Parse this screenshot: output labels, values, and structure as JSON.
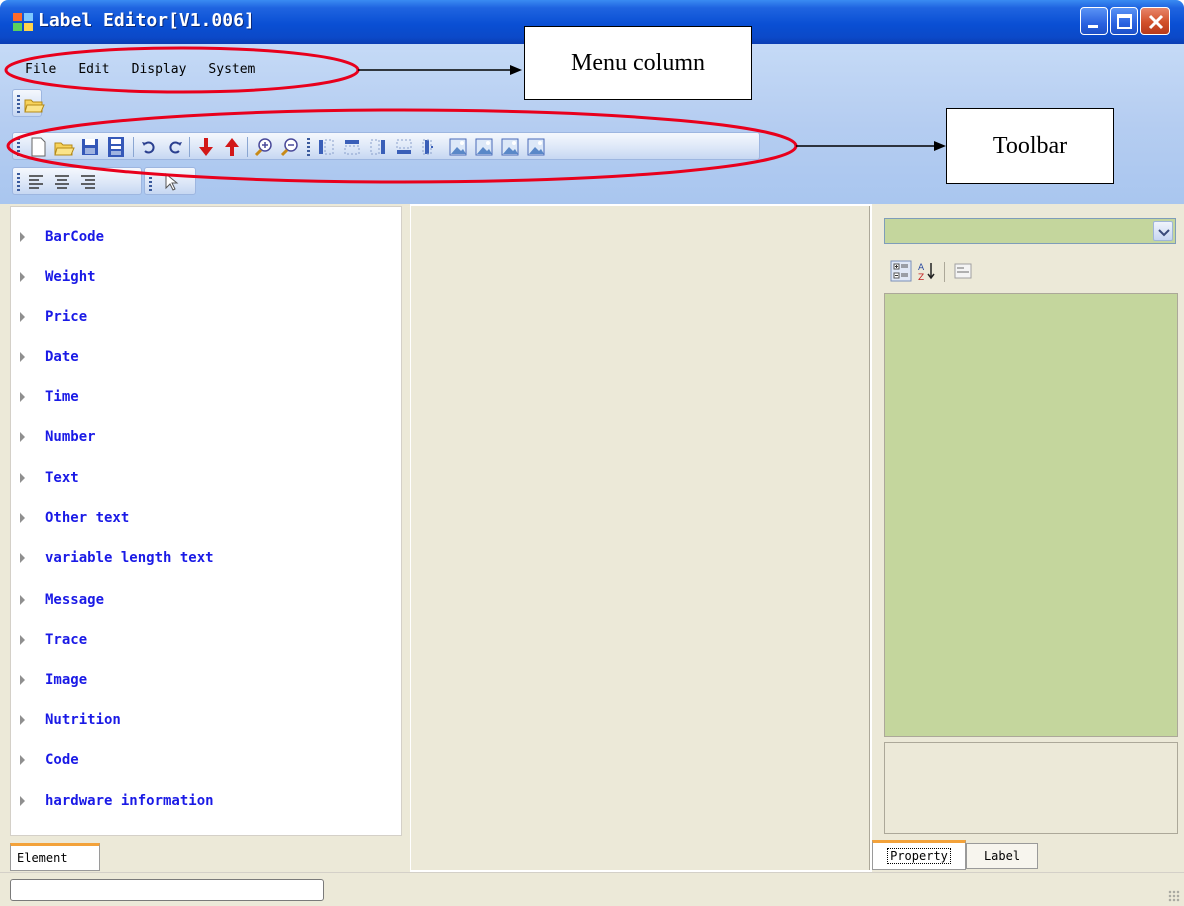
{
  "window": {
    "title": "Label Editor[V1.006]"
  },
  "menu": {
    "items": [
      "File",
      "Edit",
      "Display",
      "System"
    ]
  },
  "annotations": {
    "menu_callout": "Menu column",
    "toolbar_callout": "Toolbar",
    "highlight_color": "#e8001c"
  },
  "toolbar": {
    "row1": [
      "open-icon"
    ],
    "row2": [
      "new-icon",
      "open-folder-icon",
      "save-icon",
      "save-as-icon",
      "undo-icon",
      "redo-icon",
      "move-down-icon",
      "move-up-icon",
      "zoom-in-icon",
      "zoom-out-icon",
      "align-left-icon",
      "align-top-icon",
      "align-right-icon",
      "align-bottom-icon",
      "center-vertical-icon",
      "image-icon-1",
      "image-icon-2",
      "image-icon-3",
      "image-icon-4"
    ],
    "row3": [
      "text-align-left-icon",
      "text-align-center-icon",
      "text-align-right-icon",
      "pointer-icon"
    ]
  },
  "element_panel": {
    "items": [
      "BarCode",
      "Weight",
      "Price",
      "Date",
      "Time",
      "Number",
      "Text",
      "Other text",
      "variable length text",
      "Message",
      "Trace",
      "Image",
      "Nutrition",
      "Code",
      "hardware information"
    ],
    "tab_label": "Element"
  },
  "property_panel": {
    "tabs": [
      "Property",
      "Label"
    ],
    "grid_color": "#c4d69d"
  }
}
